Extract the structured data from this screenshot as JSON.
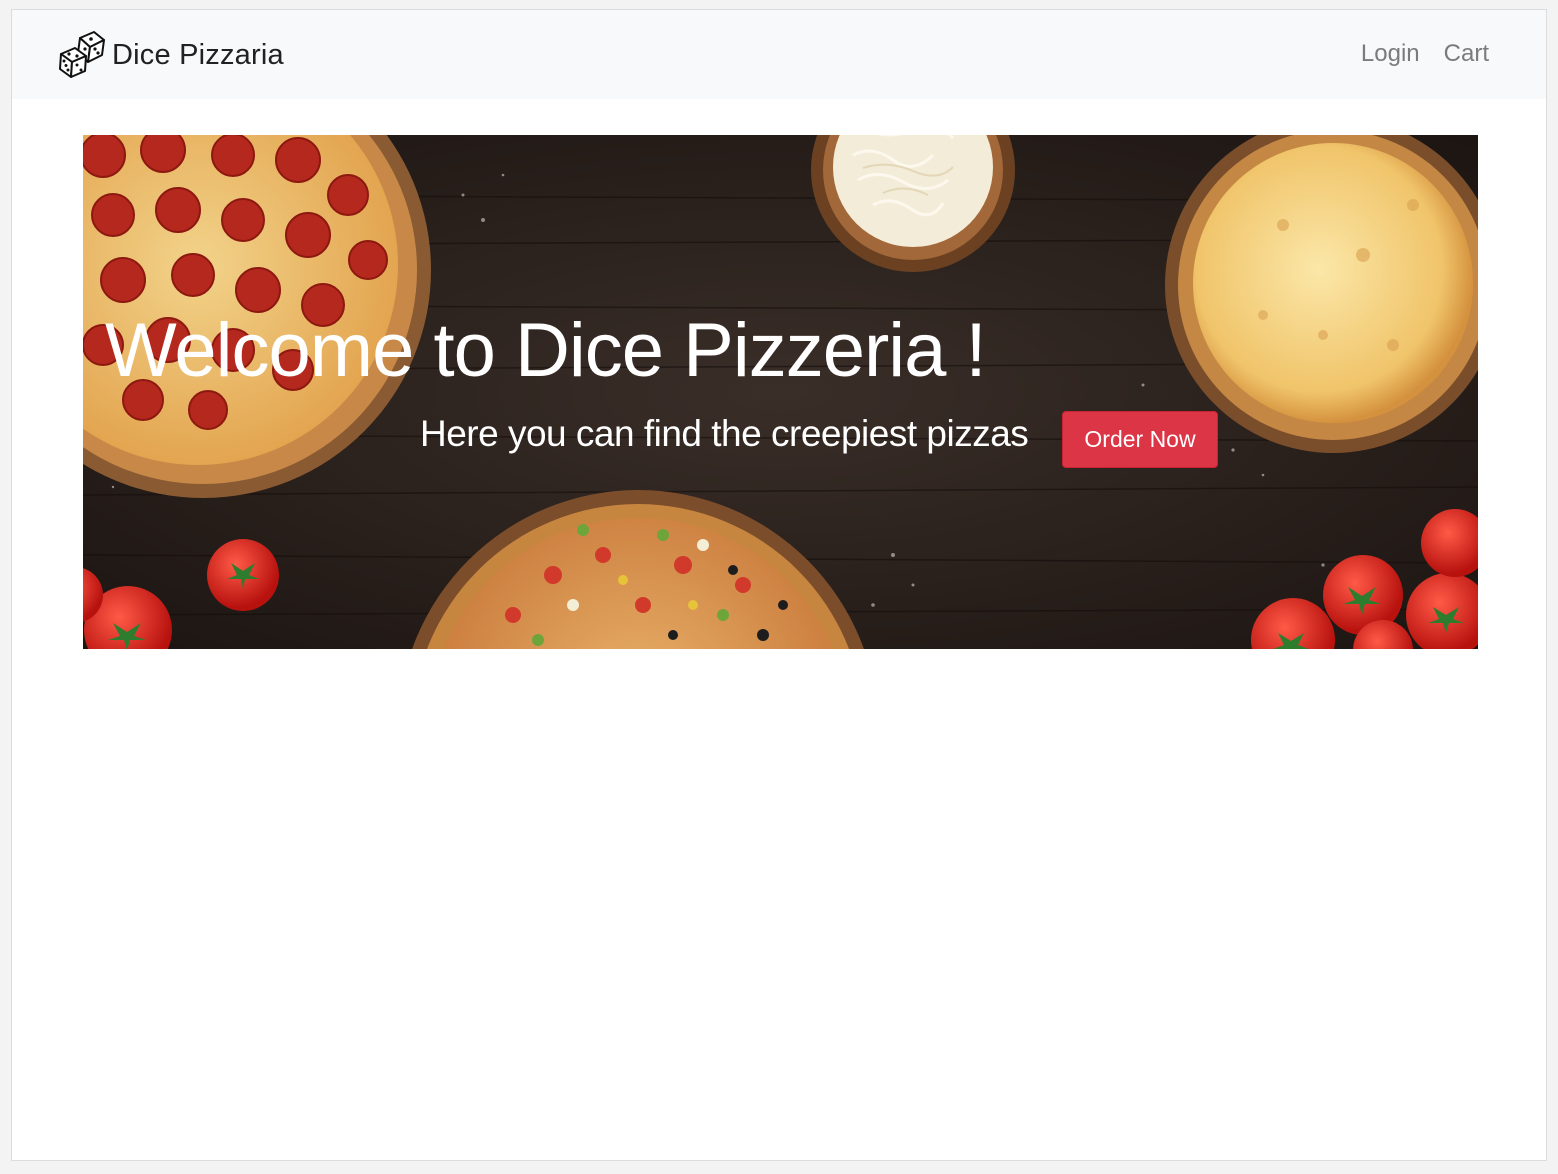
{
  "navbar": {
    "brand_name": "Dice Pizzaria",
    "brand_icon": "dice-icon",
    "links": {
      "login": "Login",
      "cart": "Cart"
    }
  },
  "hero": {
    "title": "Welcome to Dice Pizzeria !",
    "subtitle": "Here you can find the creepiest pizzas",
    "cta_label": "Order Now",
    "cta_color": "#dc3545"
  },
  "colors": {
    "navbar_bg": "#f8f9fa",
    "link_color": "#7b7b7b",
    "hero_bg": "#2a211d"
  }
}
